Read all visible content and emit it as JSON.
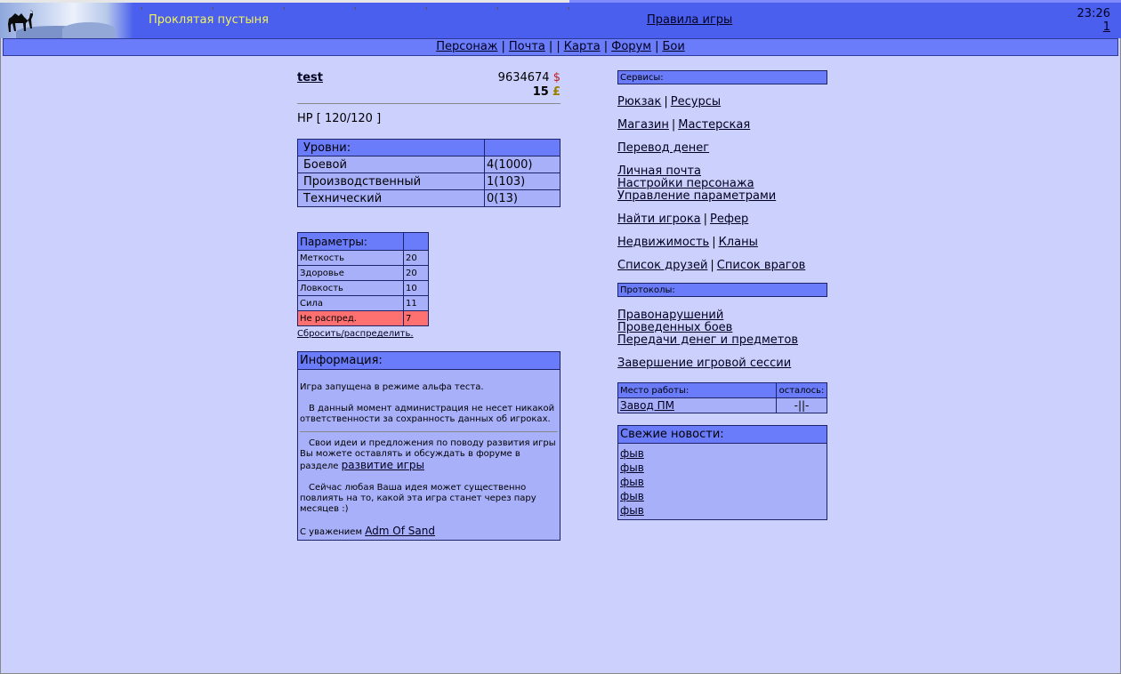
{
  "header": {
    "site_title": "Проклятая пустыня",
    "rules_link": "Правила игры",
    "time": "23:26",
    "online_count": "1"
  },
  "nav": {
    "items": [
      "Персонаж",
      "Почта",
      "Карта",
      "Форум",
      "Бои"
    ],
    "separators": [
      "|",
      "| |",
      "|",
      "|"
    ]
  },
  "character": {
    "name": "test",
    "money": "9634674",
    "money_symbol": "$",
    "pounds": "15",
    "pound_symbol": "£",
    "hp": "HP [ 120/120 ]"
  },
  "levels": {
    "header": "Уровни:",
    "rows": [
      {
        "name": "Боевой",
        "value": "4(1000)"
      },
      {
        "name": "Производственный",
        "value": "1(103)"
      },
      {
        "name": "Технический",
        "value": "0(13)"
      }
    ]
  },
  "params": {
    "header": "Параметры:",
    "rows": [
      {
        "name": "Меткость",
        "value": "20"
      },
      {
        "name": "Здоровье",
        "value": "20"
      },
      {
        "name": "Ловкость",
        "value": "10"
      },
      {
        "name": "Сила",
        "value": "11"
      },
      {
        "name": "Не распред.",
        "value": "7"
      }
    ],
    "reset_link": "Сбросить/распределить."
  },
  "info": {
    "header": "Информация:",
    "p1": "Игра запущена в режиме альфа теста.",
    "p2": "В данный момент администрация не несет никакой ответственности за сохранность данных об игроках.",
    "p3": "Свои идеи и предложения по поводу развития игры Вы можете оставлять и обсуждать в форуме в разделе",
    "p3_link": "развитие игры",
    "p4": "Сейчас любая Ваша идея может существенно повлиять на то, какой эта игра станет через пару месяцев :)",
    "sign": "С уважением",
    "sign_link": "Adm Of Sand"
  },
  "services": {
    "header": "Сервисы:",
    "backpack": "Рюкзак",
    "resources": "Ресурсы",
    "shop": "Магазин",
    "workshop": "Мастерская",
    "transfer": "Перевод денег",
    "private_mail": "Личная почта",
    "char_settings": "Настройки персонажа",
    "param_control": "Управление параметрами",
    "find_player": "Найти игрока",
    "referrer": "Рефер",
    "real_estate": "Недвижимость",
    "clans": "Кланы",
    "friends": "Список друзей",
    "enemies": "Список врагов"
  },
  "protocols": {
    "header": "Протоколы:",
    "offenses": "Правонарушений",
    "battles": "Проведенных боев",
    "transfers": "Передачи денег и предметов"
  },
  "end_session": "Завершение игровой сессии",
  "work": {
    "header": "Место работы:",
    "remaining_header": "осталось:",
    "place": "Завод ПМ",
    "remaining": "-||-"
  },
  "news": {
    "header": "Свежие новости:",
    "items": [
      "фыв",
      "фыв",
      "фыв",
      "фыв",
      "фыв"
    ]
  }
}
